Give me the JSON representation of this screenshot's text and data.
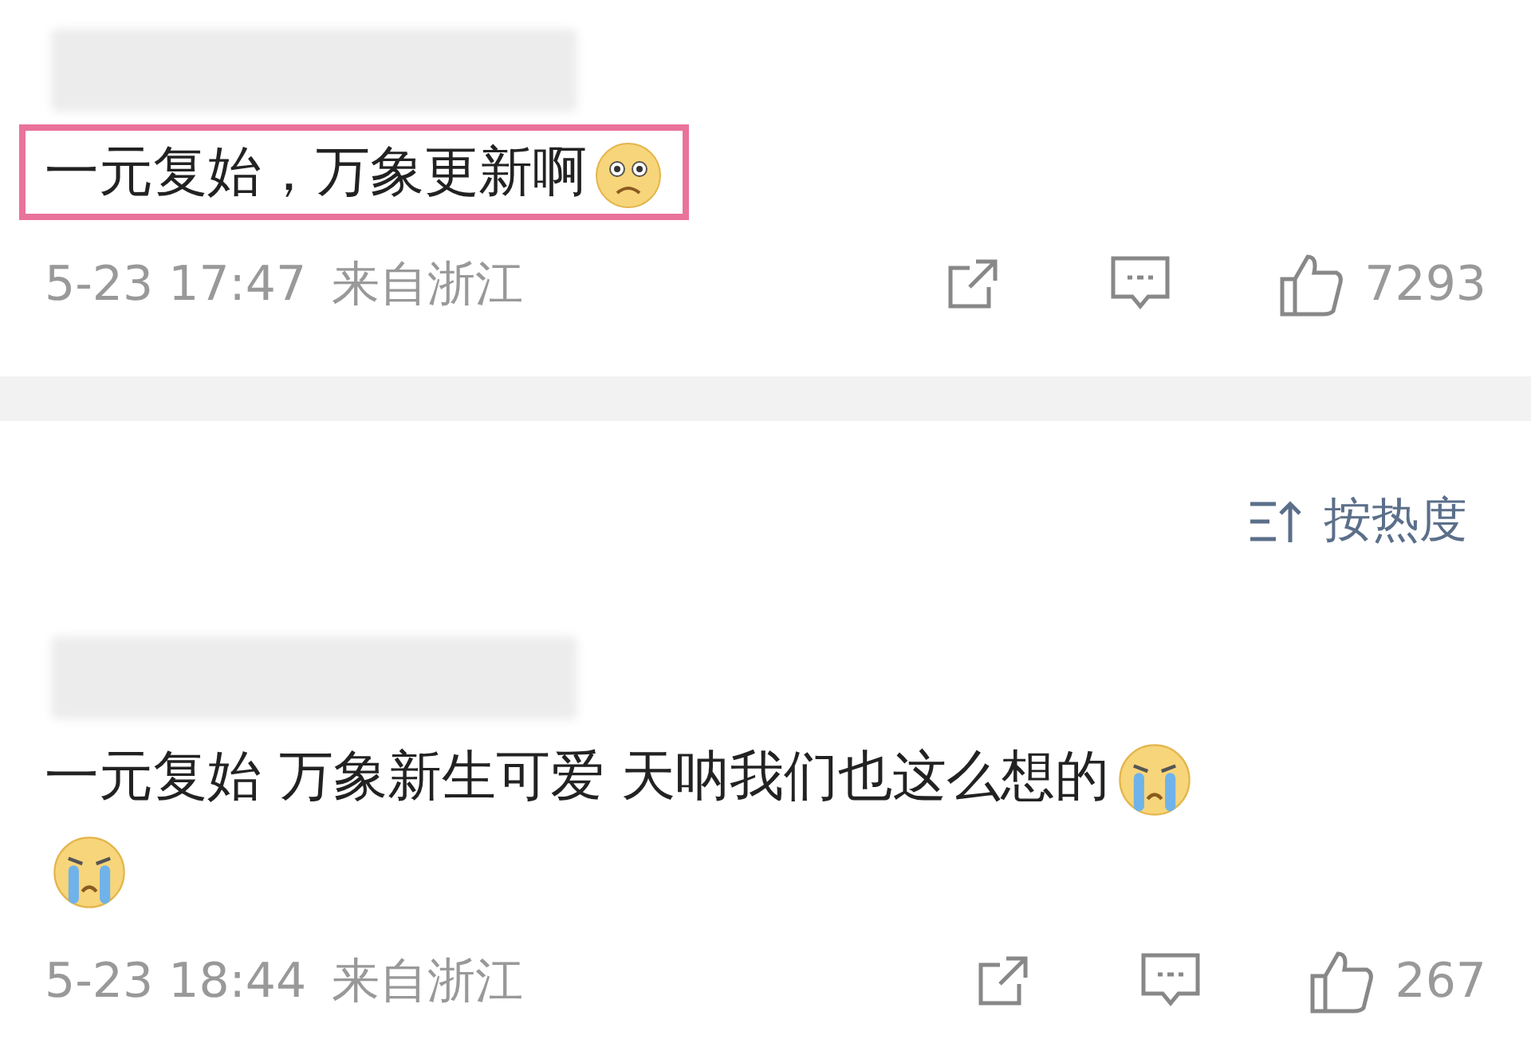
{
  "comments": [
    {
      "highlighted": true,
      "text": "一元复始，万象更新啊",
      "emojis": [
        {
          "kind": "teary"
        }
      ],
      "time": "5-23 17:47",
      "location": "来自浙江",
      "likes": "7293"
    },
    {
      "highlighted": false,
      "text": "一元复始 万象新生可爱 天呐我们也这么想的",
      "emojis": [
        {
          "kind": "crying"
        },
        {
          "kind": "crying"
        }
      ],
      "time": "5-23 18:44",
      "location": "来自浙江",
      "likes": "267"
    }
  ],
  "sort": {
    "label": "按热度"
  }
}
